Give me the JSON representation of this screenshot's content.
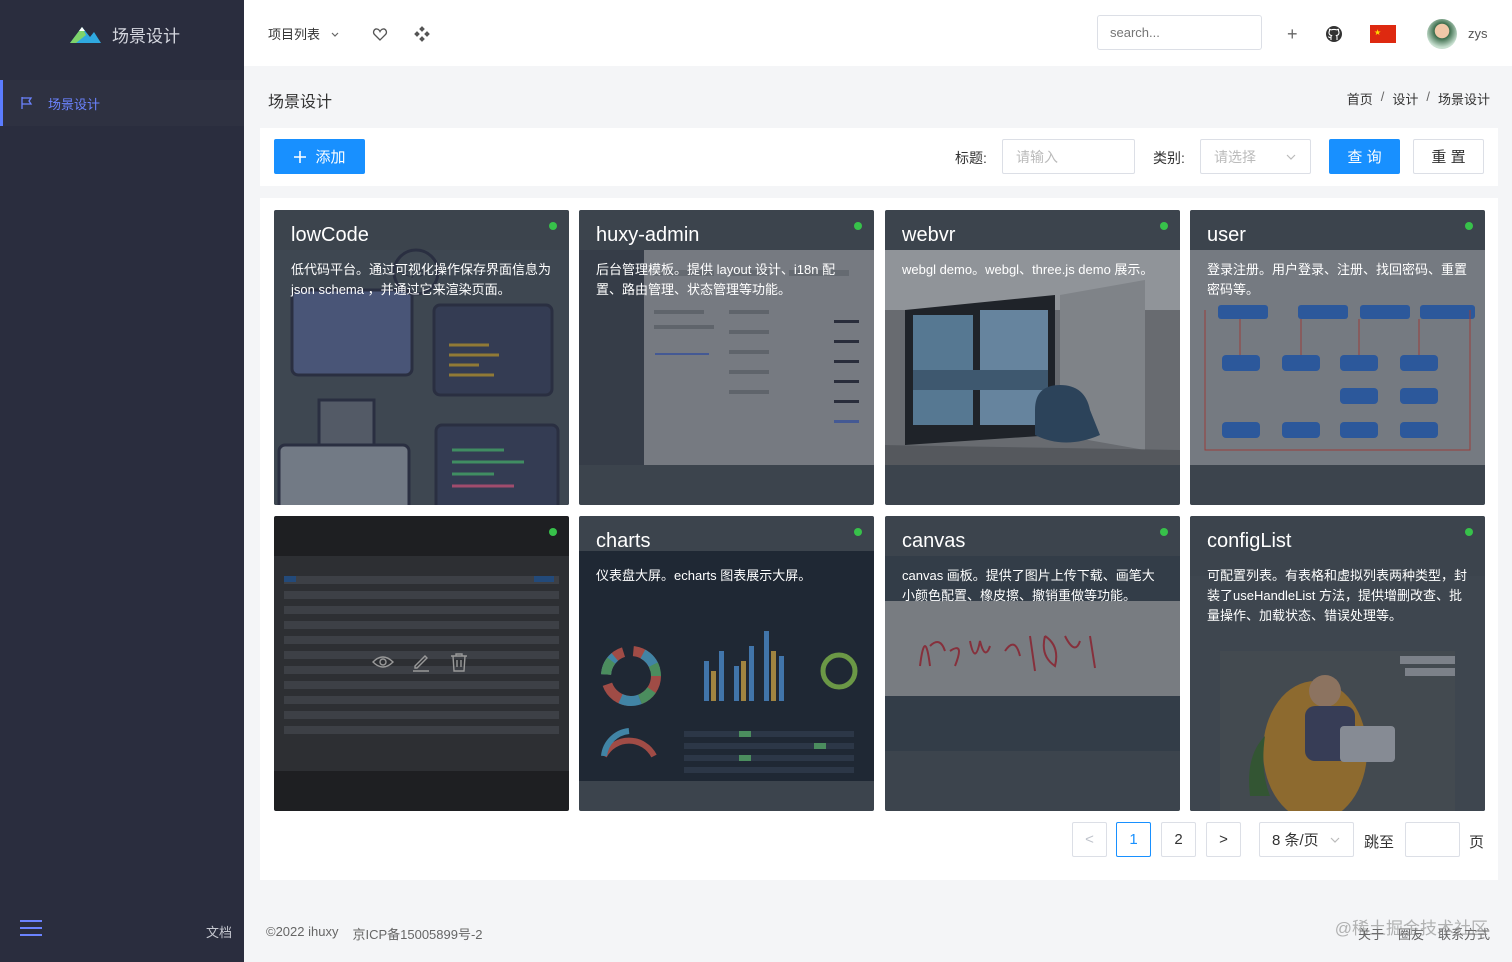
{
  "app": {
    "name": "场景设计"
  },
  "sidebar": {
    "menu_item": "场景设计",
    "docs": "文档"
  },
  "header": {
    "project_list": "项目列表",
    "search_placeholder": "search...",
    "plus": "+",
    "username": "zys"
  },
  "page": {
    "title": "场景设计",
    "breadcrumbs": [
      "首页",
      "设计",
      "场景设计"
    ],
    "breadcrumb_sep": "/"
  },
  "toolbar": {
    "add_label": "添加",
    "title_label": "标题:",
    "title_placeholder": "请输入",
    "category_label": "类别:",
    "category_placeholder": "请选择",
    "query_label": "查 询",
    "reset_label": "重 置"
  },
  "cards": [
    {
      "title": "lowCode",
      "desc": "低代码平台。通过可视化操作保存界面信息为 json schema ，并通过它来渲染页面。"
    },
    {
      "title": "huxy-admin",
      "desc": "后台管理模板。提供 layout 设计、i18n 配置、路由管理、状态管理等功能。"
    },
    {
      "title": "webvr",
      "desc": "webgl demo。webgl、three.js demo 展示。"
    },
    {
      "title": "user",
      "desc": "登录注册。用户登录、注册、找回密码、重置密码等。"
    },
    {
      "title": "",
      "desc": ""
    },
    {
      "title": "charts",
      "desc": "仪表盘大屏。echarts 图表展示大屏。"
    },
    {
      "title": "canvas",
      "desc": "canvas 画板。提供了图片上传下载、画笔大小颜色配置、橡皮擦、撤销重做等功能。"
    },
    {
      "title": "configList",
      "desc": "可配置列表。有表格和虚拟列表两种类型，封装了useHandleList 方法，提供增删改查、批量操作、加载状态、错误处理等。"
    }
  ],
  "pagination": {
    "prev": "<",
    "pages": [
      "1",
      "2"
    ],
    "current_page": 1,
    "next": ">",
    "page_size": "8 条/页",
    "jump_label": "跳至",
    "page_suffix": "页"
  },
  "footer": {
    "copyright": "©2022 ihuxy",
    "icp": "京ICP备15005899号-2",
    "links": [
      "关于",
      "圈友",
      "联系方式"
    ],
    "watermark": "@稀土掘金技术社区"
  },
  "colors": {
    "primary": "#1890ff",
    "sidebar_bg": "#2a2d3e",
    "sidebar_active": "#6b83ff",
    "status_dot": "#37c14a"
  },
  "icons": [
    "logo-icon",
    "flag-icon",
    "chevron-down-icon",
    "heart-icon",
    "apps-icon",
    "plus-icon",
    "github-icon",
    "cn-flag-icon",
    "avatar",
    "menu-collapse-icon",
    "eye-icon",
    "edit-icon",
    "delete-icon"
  ]
}
